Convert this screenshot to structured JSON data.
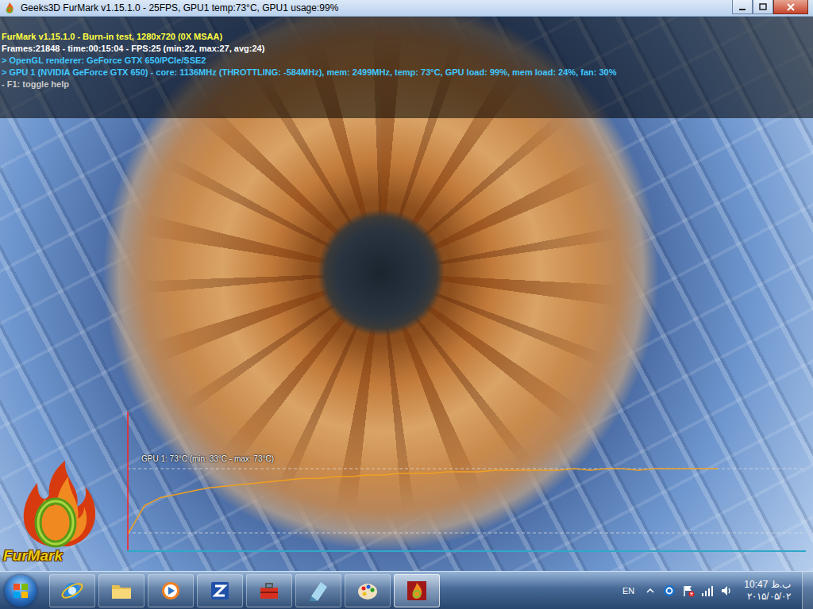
{
  "window": {
    "title": "Geeks3D FurMark v1.15.1.0 - 25FPS, GPU1 temp:73°C, GPU1 usage:99%"
  },
  "overlay": {
    "lines": [
      {
        "text": "FurMark v1.15.1.0 - Burn-in test, 1280x720 (0X MSAA)",
        "color": "#ffff40"
      },
      {
        "text": "Frames:21848 - time:00:15:04 - FPS:25 (min:22, max:27, avg:24)",
        "color": "#ffffff"
      },
      {
        "text": "> OpenGL renderer: GeForce GTX 650/PCIe/SSE2",
        "color": "#40c8ff"
      },
      {
        "text": "> GPU 1 (NVIDIA GeForce GTX 650) - core: 1136MHz (THROTTLING: -584MHz), mem: 2499MHz, temp: 73°C, GPU load: 99%, mem load: 24%, fan: 30%",
        "color": "#40c8ff"
      },
      {
        "text": "- F1: toggle help",
        "color": "#c8c8c8"
      }
    ]
  },
  "chart": {
    "label": "GPU 1: 73°C (min: 33°C - max: 73°C)",
    "values": [
      33,
      50,
      55,
      57,
      59,
      61,
      62,
      63,
      64,
      65,
      66,
      67,
      67,
      68,
      68,
      69,
      69,
      70,
      70,
      70,
      71,
      71,
      71,
      72,
      72,
      72,
      72,
      72,
      73,
      72,
      73,
      73,
      72,
      73,
      73,
      73,
      73,
      73
    ]
  },
  "logo": {
    "text": "FurMark"
  },
  "taskbar": {
    "language": "EN",
    "time": "10:47 ب.ظ",
    "date": "۲۰۱۵/۰۵/۰۲"
  }
}
